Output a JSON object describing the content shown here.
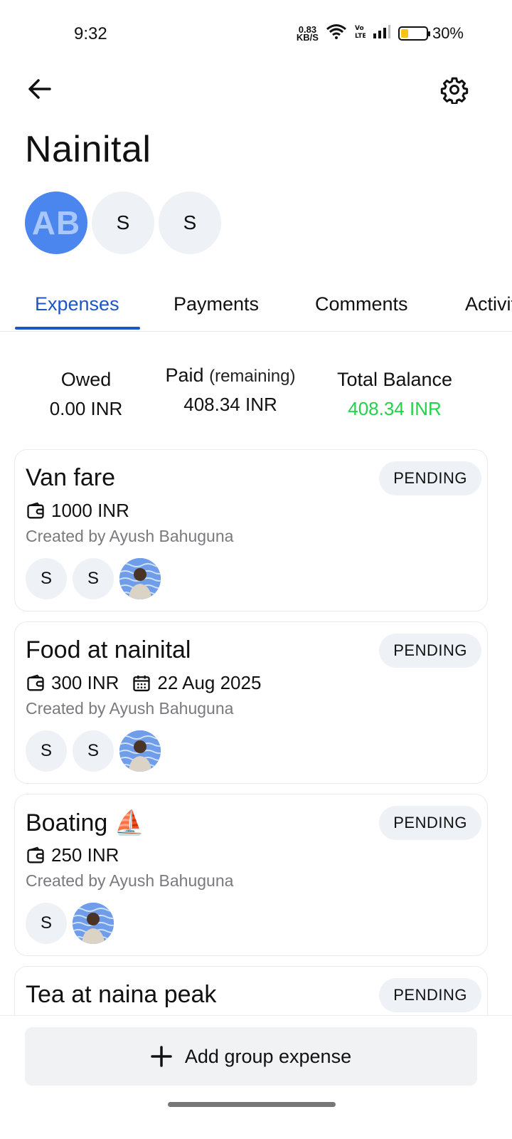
{
  "status": {
    "time": "9:32",
    "net_speed_value": "0.83",
    "net_speed_unit": "KB/S",
    "battery": "30%",
    "battery_level": 0.3,
    "icons": [
      "wifi-icon",
      "volte-icon",
      "signal-icon",
      "battery-icon"
    ]
  },
  "header": {
    "back_icon": "arrow-left-icon",
    "settings_icon": "gear-icon",
    "title": "Nainital"
  },
  "members": [
    {
      "initials": "AB",
      "color": "#4b86ef"
    },
    {
      "initials": "S"
    },
    {
      "initials": "S"
    }
  ],
  "tabs": [
    {
      "label": "Expenses",
      "active": true
    },
    {
      "label": "Payments"
    },
    {
      "label": "Comments"
    },
    {
      "label": "Activity"
    }
  ],
  "summary": {
    "owed_label": "Owed",
    "owed_value": "0.00 INR",
    "paid_label": "Paid",
    "paid_sub": "(remaining)",
    "paid_value": "408.34 INR",
    "total_label": "Total Balance",
    "total_value": "408.34 INR",
    "total_color": "#22d34a"
  },
  "expenses": [
    {
      "title": "Van fare",
      "status": "PENDING",
      "amount": "1000 INR",
      "date": "",
      "created_by": "Created by Ayush Bahuguna",
      "participants": [
        "S",
        "S"
      ]
    },
    {
      "title": "Food at nainital",
      "status": "PENDING",
      "amount": "300 INR",
      "date": "22 Aug 2025",
      "created_by": "Created by Ayush Bahuguna",
      "participants": [
        "S",
        "S"
      ]
    },
    {
      "title": "Boating ⛵",
      "status": "PENDING",
      "amount": "250 INR",
      "date": "",
      "created_by": "Created by Ayush Bahuguna",
      "participants": [
        "S"
      ]
    },
    {
      "title": "Tea at naina peak",
      "status": "PENDING"
    }
  ],
  "footer": {
    "add_label": "Add group expense",
    "add_icon": "plus-icon"
  }
}
